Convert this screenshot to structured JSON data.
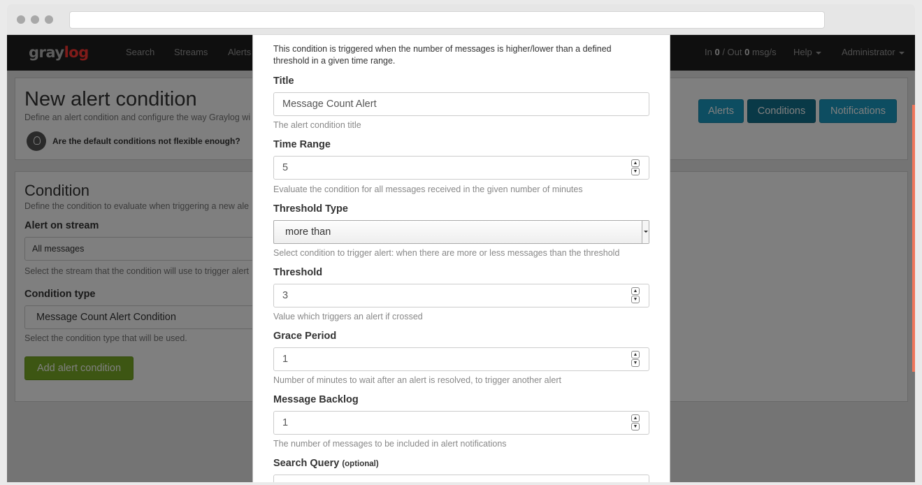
{
  "nav": {
    "logo_gray": "gray",
    "logo_log": "log",
    "items": [
      "Search",
      "Streams",
      "Alerts"
    ],
    "throughput_in_label": "In ",
    "throughput_in": "0",
    "throughput_out_label": " / Out ",
    "throughput_out": "0",
    "throughput_unit": " msg/s",
    "help": "Help",
    "user": "Administrator"
  },
  "header": {
    "title": "New alert condition",
    "subtitle": "Define an alert condition and configure the way Graylog wi",
    "hint": "Are the default conditions not flexible enough?",
    "buttons": [
      "Alerts",
      "Conditions",
      "Notifications"
    ],
    "active_button": "Conditions"
  },
  "condition": {
    "title": "Condition",
    "subtitle": "Define the condition to evaluate when triggering a new ale",
    "stream_label": "Alert on stream",
    "stream_value": "All messages",
    "stream_help": "Select the stream that the condition will use to trigger alert",
    "type_label": "Condition type",
    "type_value": "Message Count Alert Condition",
    "type_help": "Select the condition type that will be used.",
    "add_button": "Add alert condition"
  },
  "modal": {
    "description": "This condition is triggered when the number of messages is higher/lower than a defined threshold in a given time range.",
    "title_label": "Title",
    "title_value": "Message Count Alert",
    "title_help": "The alert condition title",
    "time_range_label": "Time Range",
    "time_range_value": "5",
    "time_range_help": "Evaluate the condition for all messages received in the given number of minutes",
    "threshold_type_label": "Threshold Type",
    "threshold_type_value": "more than",
    "threshold_type_help": "Select condition to trigger alert: when there are more or less messages than the threshold",
    "threshold_label": "Threshold",
    "threshold_value": "3",
    "threshold_help": "Value which triggers an alert if crossed",
    "grace_label": "Grace Period",
    "grace_value": "1",
    "grace_help": "Number of minutes to wait after an alert is resolved, to trigger another alert",
    "backlog_label": "Message Backlog",
    "backlog_value": "1",
    "backlog_help": "The number of messages to be included in alert notifications",
    "query_label": "Search Query",
    "query_optional": "(optional)",
    "query_value": ""
  },
  "colors": {
    "accent_blue": "#1b9bc2",
    "accent_green": "#7bad26",
    "brand_red": "#ff3633",
    "scroll_orange": "#f0765b"
  }
}
